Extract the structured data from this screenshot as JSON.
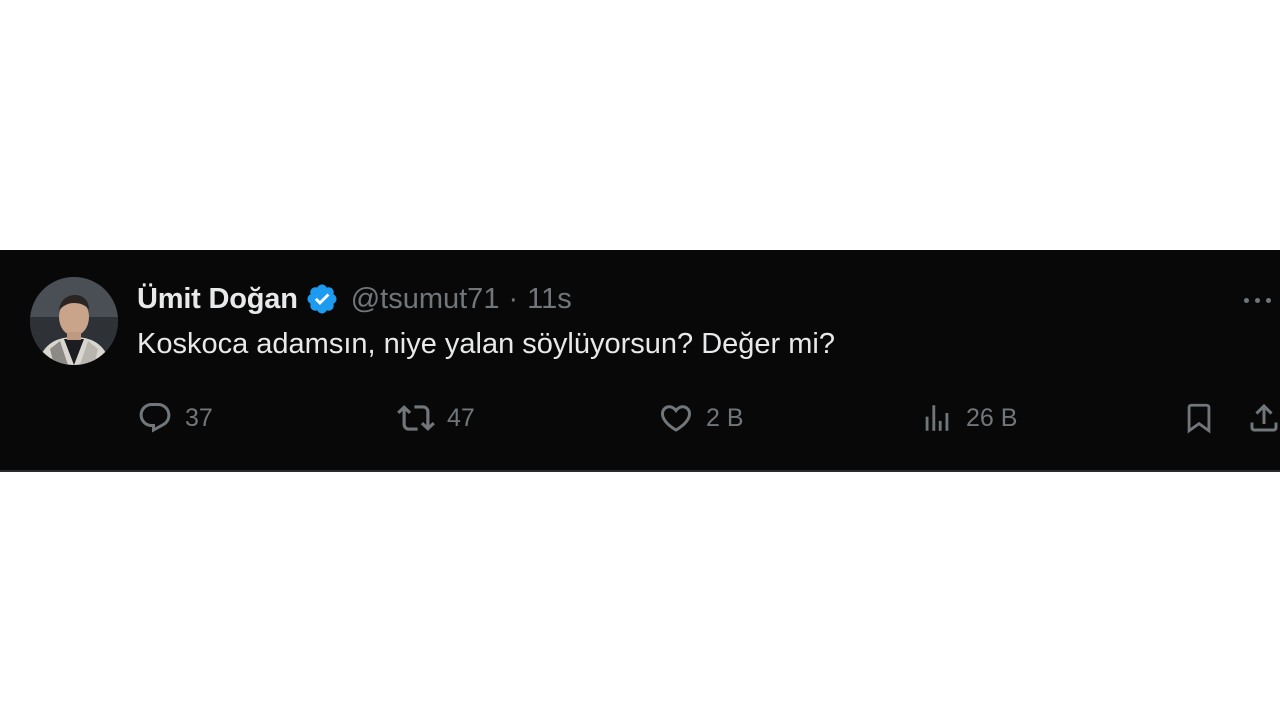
{
  "tweet": {
    "author": {
      "display_name": "Ümit Doğan",
      "handle": "@tsumut71",
      "verified": true
    },
    "separator": "·",
    "time": "11s",
    "text": "Koskoca adamsın, niye yalan söylüyorsun? Değer mi?",
    "actions": {
      "replies": "37",
      "reposts": "47",
      "likes": "2 B",
      "views": "26 B"
    }
  },
  "colors": {
    "background": "#080808",
    "primary_text": "#e7e9ea",
    "secondary_text": "#71767b",
    "verified_badge": "#1d9bf0"
  },
  "icons": [
    "reply-icon",
    "repost-icon",
    "like-icon",
    "views-icon",
    "bookmark-icon",
    "share-icon",
    "more-icon",
    "verified-badge-icon"
  ]
}
